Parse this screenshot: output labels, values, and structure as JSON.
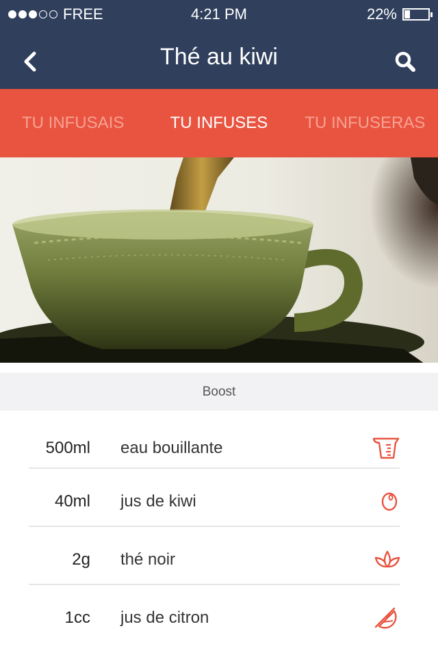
{
  "status_bar": {
    "carrier": "FREE",
    "signal_strength": 3,
    "signal_max": 5,
    "time": "4:21  PM",
    "battery_text": "22%",
    "battery_level": 0.22
  },
  "nav": {
    "title": "Thé au kiwi",
    "back_icon": "chevron-left-icon",
    "search_icon": "search-icon"
  },
  "tabs": [
    {
      "label": "TU INFUSAIS",
      "active": false
    },
    {
      "label": "TU INFUSES",
      "active": true
    },
    {
      "label": "TU INFUSERAS",
      "active": false
    }
  ],
  "hero_image": {
    "subject": "green teacup being filled with tea"
  },
  "section": {
    "title": "Boost"
  },
  "ingredients": [
    {
      "quantity": "500ml",
      "name": "eau bouillante",
      "icon": "measuring-cup-icon"
    },
    {
      "quantity": "40ml",
      "name": "jus de kiwi",
      "icon": "kiwi-icon"
    },
    {
      "quantity": "2g",
      "name": "thé noir",
      "icon": "tea-leaf-icon"
    },
    {
      "quantity": "1cc",
      "name": "jus de citron",
      "icon": "lemon-slice-icon"
    }
  ],
  "colors": {
    "header_bg": "#2f3f5c",
    "tab_bg": "#e95440",
    "tab_inactive": "#f8a293",
    "accent": "#e95440"
  }
}
